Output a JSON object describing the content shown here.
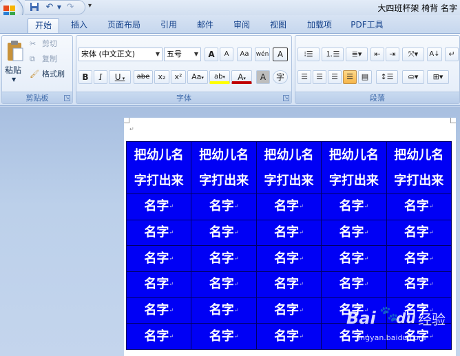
{
  "window": {
    "title": "大四班杯架 椅背 名字"
  },
  "qat": {
    "undo_icon": "undo-icon",
    "redo_icon": "redo-icon",
    "save_icon": "save-icon",
    "dropdown": "▼"
  },
  "tabs": [
    {
      "label": "开始",
      "active": true
    },
    {
      "label": "插入"
    },
    {
      "label": "页面布局"
    },
    {
      "label": "引用"
    },
    {
      "label": "邮件"
    },
    {
      "label": "审阅"
    },
    {
      "label": "视图"
    },
    {
      "label": "加载项"
    },
    {
      "label": "PDF工具"
    }
  ],
  "clipboard": {
    "paste": "粘贴",
    "cut": "剪切",
    "copy": "复制",
    "format_painter": "格式刷",
    "label": "剪贴板"
  },
  "font": {
    "name": "宋体 (中文正文)",
    "size": "五号",
    "label": "字体",
    "grow": "A",
    "shrink": "A",
    "bold": "B",
    "italic": "I",
    "underline": "U",
    "strike": "abe",
    "sub": "x₂",
    "sup": "x²",
    "case": "Aa",
    "highlight": "ab",
    "color": "A",
    "char_shade": "A",
    "enclose": "字",
    "clear_format": "Aa",
    "phonetic": "wén",
    "border": "A"
  },
  "paragraph": {
    "label": "段落"
  },
  "document": {
    "header_row": [
      "把幼儿名字打出来",
      "把幼儿名字打出来",
      "把幼儿名字打出来",
      "把幼儿名字打出来",
      "把幼儿名字打出来"
    ],
    "header_line1": "把幼儿名",
    "header_line2": "字打出来",
    "cell_text": "名字",
    "rows": 6,
    "cols": 5
  },
  "watermark": {
    "brand": "Bai",
    "paw": "du",
    "site_cn": "经验",
    "url": "jingyan.baidu.com"
  },
  "colors": {
    "table_fill": "#0000f5",
    "cell_text": "#ffffff"
  }
}
